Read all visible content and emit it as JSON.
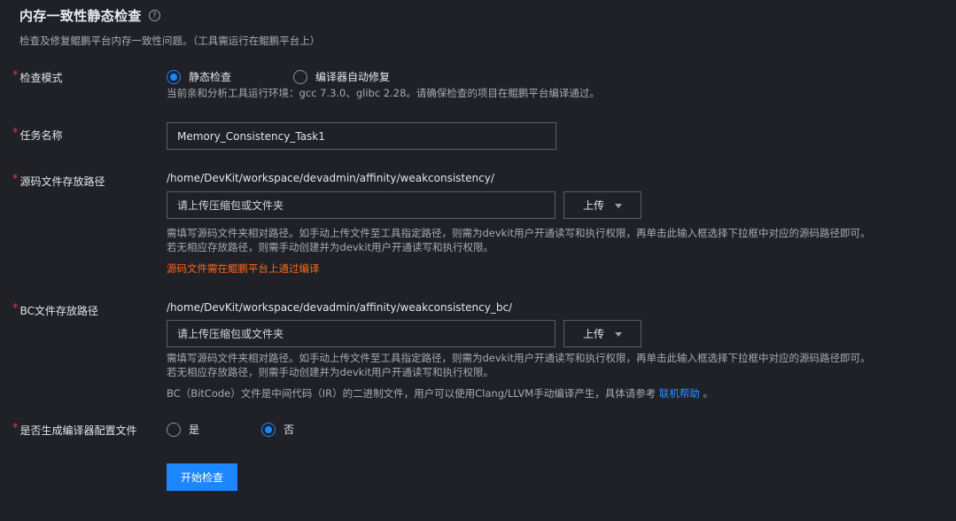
{
  "header": {
    "title": "内存一致性静态检查",
    "help_icon": "?",
    "subtitle": "检查及修复鲲鹏平台内存一致性问题。（工具需运行在鲲鹏平台上）"
  },
  "required_mark": "*",
  "check_mode": {
    "label": "检查模式",
    "options": [
      "静态检查",
      "编译器自动修复"
    ],
    "selected": "静态检查",
    "hint": "当前亲和分析工具运行环境：gcc 7.3.0、glibc 2.28。请确保检查的项目在鲲鹏平台编译通过。"
  },
  "task_name": {
    "label": "任务名称",
    "value": "Memory_Consistency_Task1"
  },
  "source_path": {
    "label": "源码文件存放路径",
    "path": "/home/DevKit/workspace/devadmin/affinity/weakconsistency/",
    "placeholder": "请上传压缩包或文件夹",
    "upload_label": "上传",
    "hint_line1": "需填写源码文件夹相对路径。如手动上传文件至工具指定路径，则需为devkit用户开通读写和执行权限，再单击此输入框选择下拉框中对应的源码路径即可。",
    "hint_line2": "若无相应存放路径，则需手动创建并为devkit用户开通读写和执行权限。",
    "warning": "源码文件需在鲲鹏平台上通过编译"
  },
  "bc_path": {
    "label": "BC文件存放路径",
    "path": "/home/DevKit/workspace/devadmin/affinity/weakconsistency_bc/",
    "placeholder": "请上传压缩包或文件夹",
    "upload_label": "上传",
    "hint_line1": "需填写源码文件夹相对路径。如手动上传文件至工具指定路径，则需为devkit用户开通读写和执行权限，再单击此输入框选择下拉框中对应的源码路径即可。",
    "hint_line2": "若无相应存放路径，则需手动创建并为devkit用户开通读写和执行权限。",
    "bc_note": "BC（BitCode）文件是中间代码（IR）的二进制文件，用户可以使用Clang/LLVM手动编译产生，具体请参考",
    "link": "联机帮助",
    "bc_note_end": "。"
  },
  "gen_config": {
    "label": "是否生成编译器配置文件",
    "options": [
      "是",
      "否"
    ],
    "selected": "否"
  },
  "submit": {
    "label": "开始检查"
  },
  "colors": {
    "accent": "#1c86ff",
    "required": "#e0393e",
    "warning": "#f56a1d",
    "link": "#2f8fff"
  }
}
